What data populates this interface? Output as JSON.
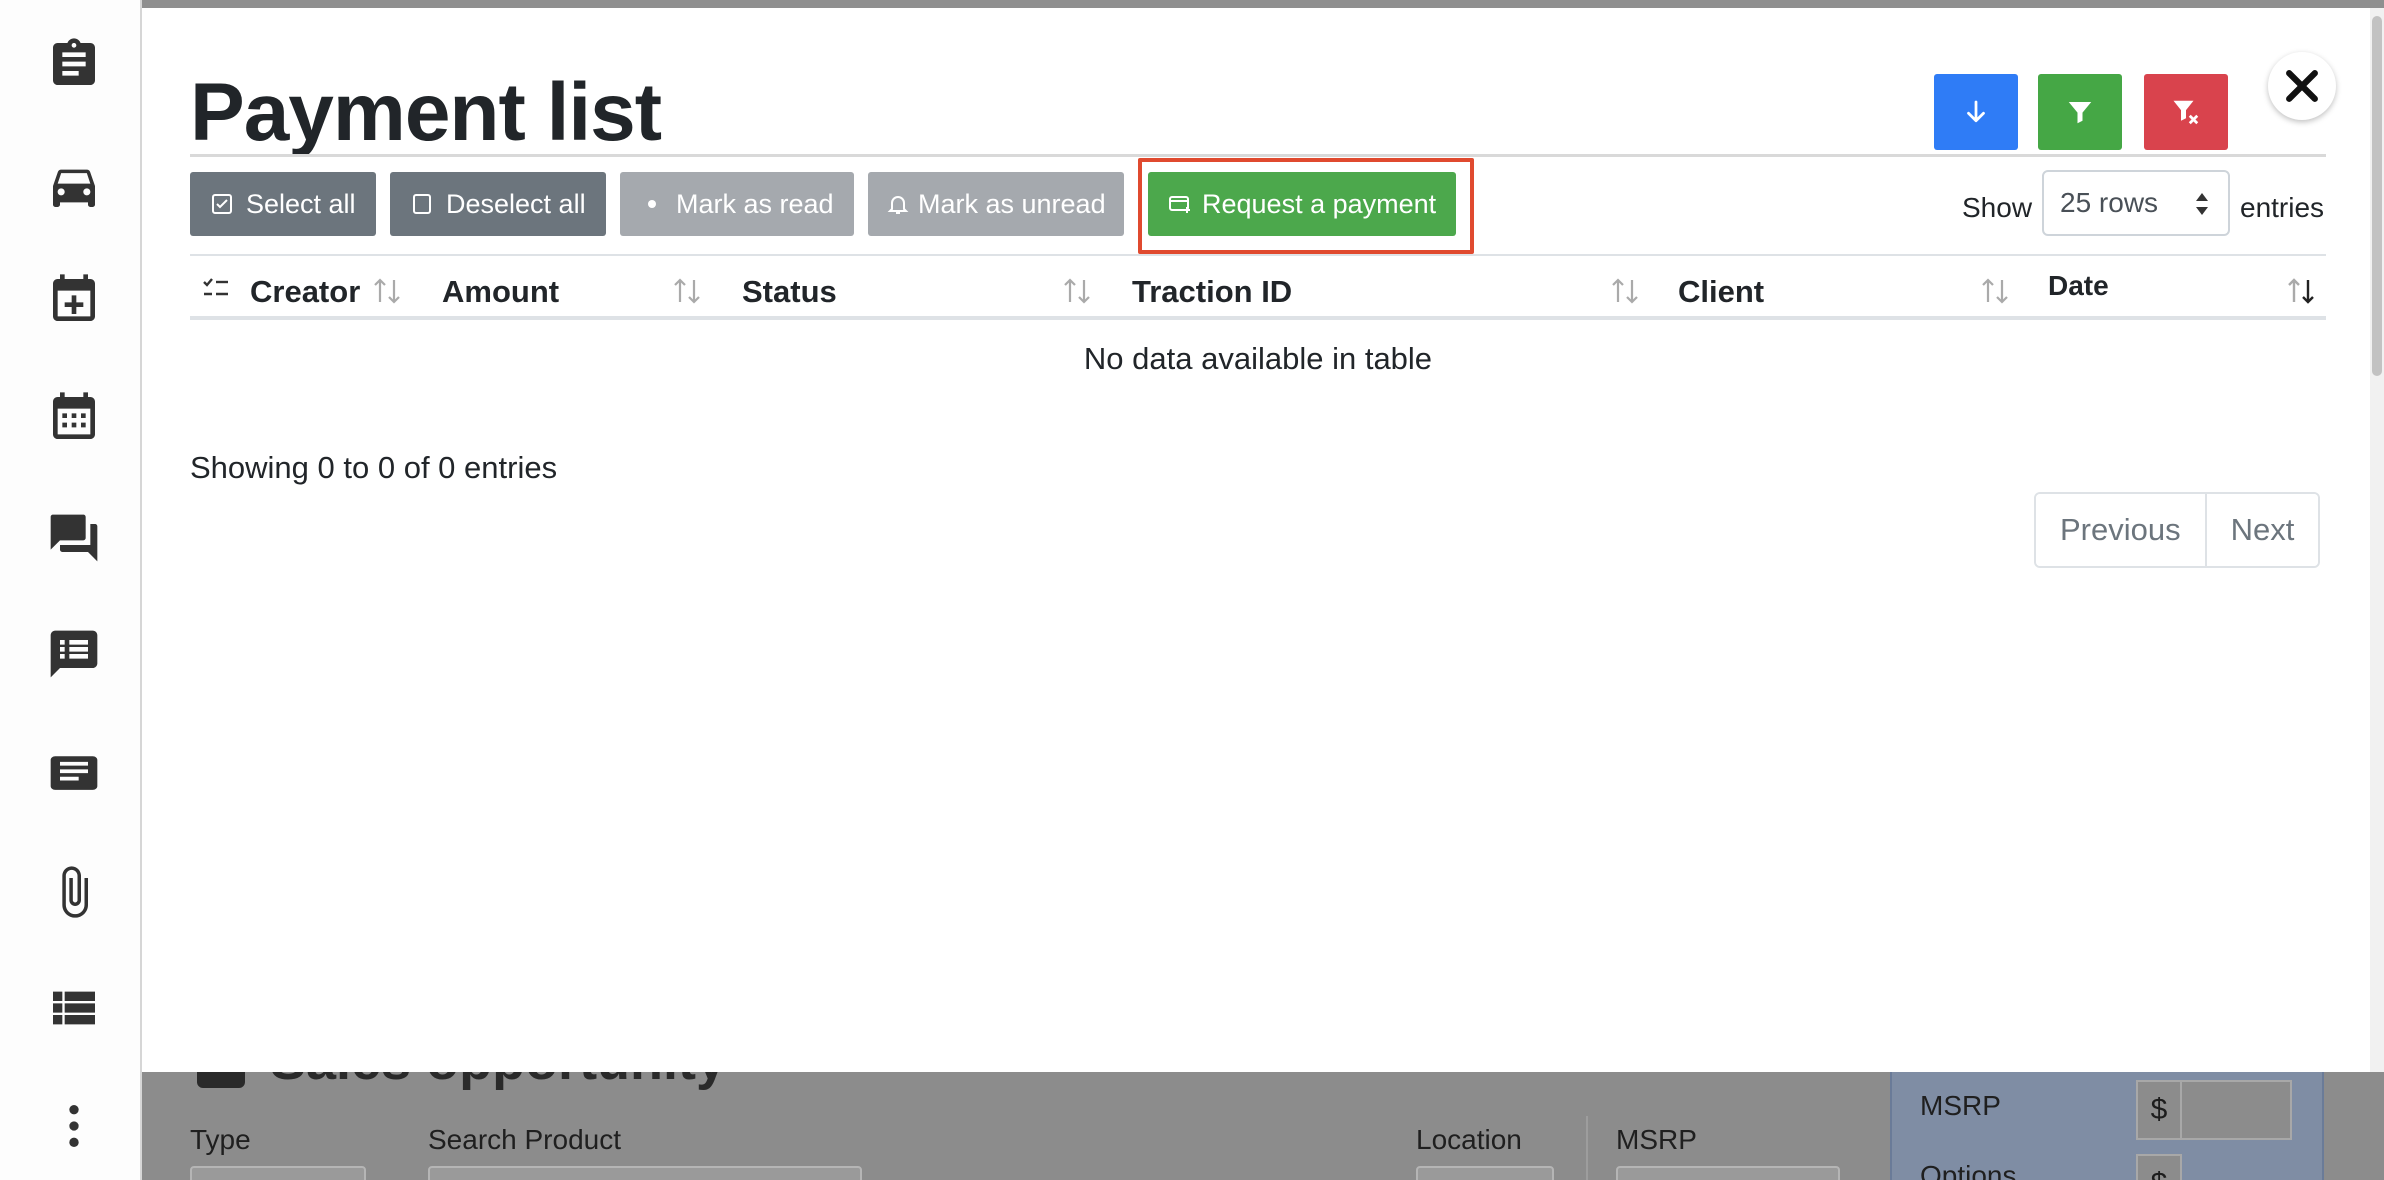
{
  "sidebar": {
    "items": [
      {
        "icon": "clipboard-icon"
      },
      {
        "icon": "car-icon"
      },
      {
        "icon": "calendar-plus-icon"
      },
      {
        "icon": "calendar-icon"
      },
      {
        "icon": "chat-bubbles-icon"
      },
      {
        "icon": "chat-list-icon"
      },
      {
        "icon": "notes-icon"
      },
      {
        "icon": "paperclip-icon"
      },
      {
        "icon": "list-view-icon"
      },
      {
        "icon": "more-vertical-icon"
      }
    ]
  },
  "background_page": {
    "section_title": "Sales opportunity",
    "labels": {
      "type": "Type",
      "search_product": "Search Product",
      "location": "Location",
      "msrp": "MSRP",
      "msrp_panel": "MSRP",
      "options_panel": "Options"
    },
    "currency_symbol": "$"
  },
  "modal": {
    "title": "Payment list",
    "toolbar_icons": [
      {
        "name": "download-icon",
        "color": "#2f7cf6"
      },
      {
        "name": "filter-icon",
        "color": "#45a745"
      },
      {
        "name": "clear-filter-icon",
        "color": "#d9434d"
      }
    ],
    "actions": {
      "select_all": "Select all",
      "deselect_all": "Deselect all",
      "mark_as_read": "Mark as read",
      "mark_as_unread": "Mark as unread",
      "request_payment": "Request a payment"
    },
    "length": {
      "show": "Show",
      "selected": "25 rows",
      "entries": "entries"
    },
    "table": {
      "columns": [
        "Creator",
        "Amount",
        "Status",
        "Traction ID",
        "Client",
        "Date"
      ],
      "empty_message": "No data available in table",
      "info": "Showing 0 to 0 of 0 entries"
    },
    "pagination": {
      "previous": "Previous",
      "next": "Next"
    }
  },
  "colors": {
    "highlight": "#e04a2f",
    "primary_green": "#4ca84c",
    "secondary": "#6c757d"
  }
}
